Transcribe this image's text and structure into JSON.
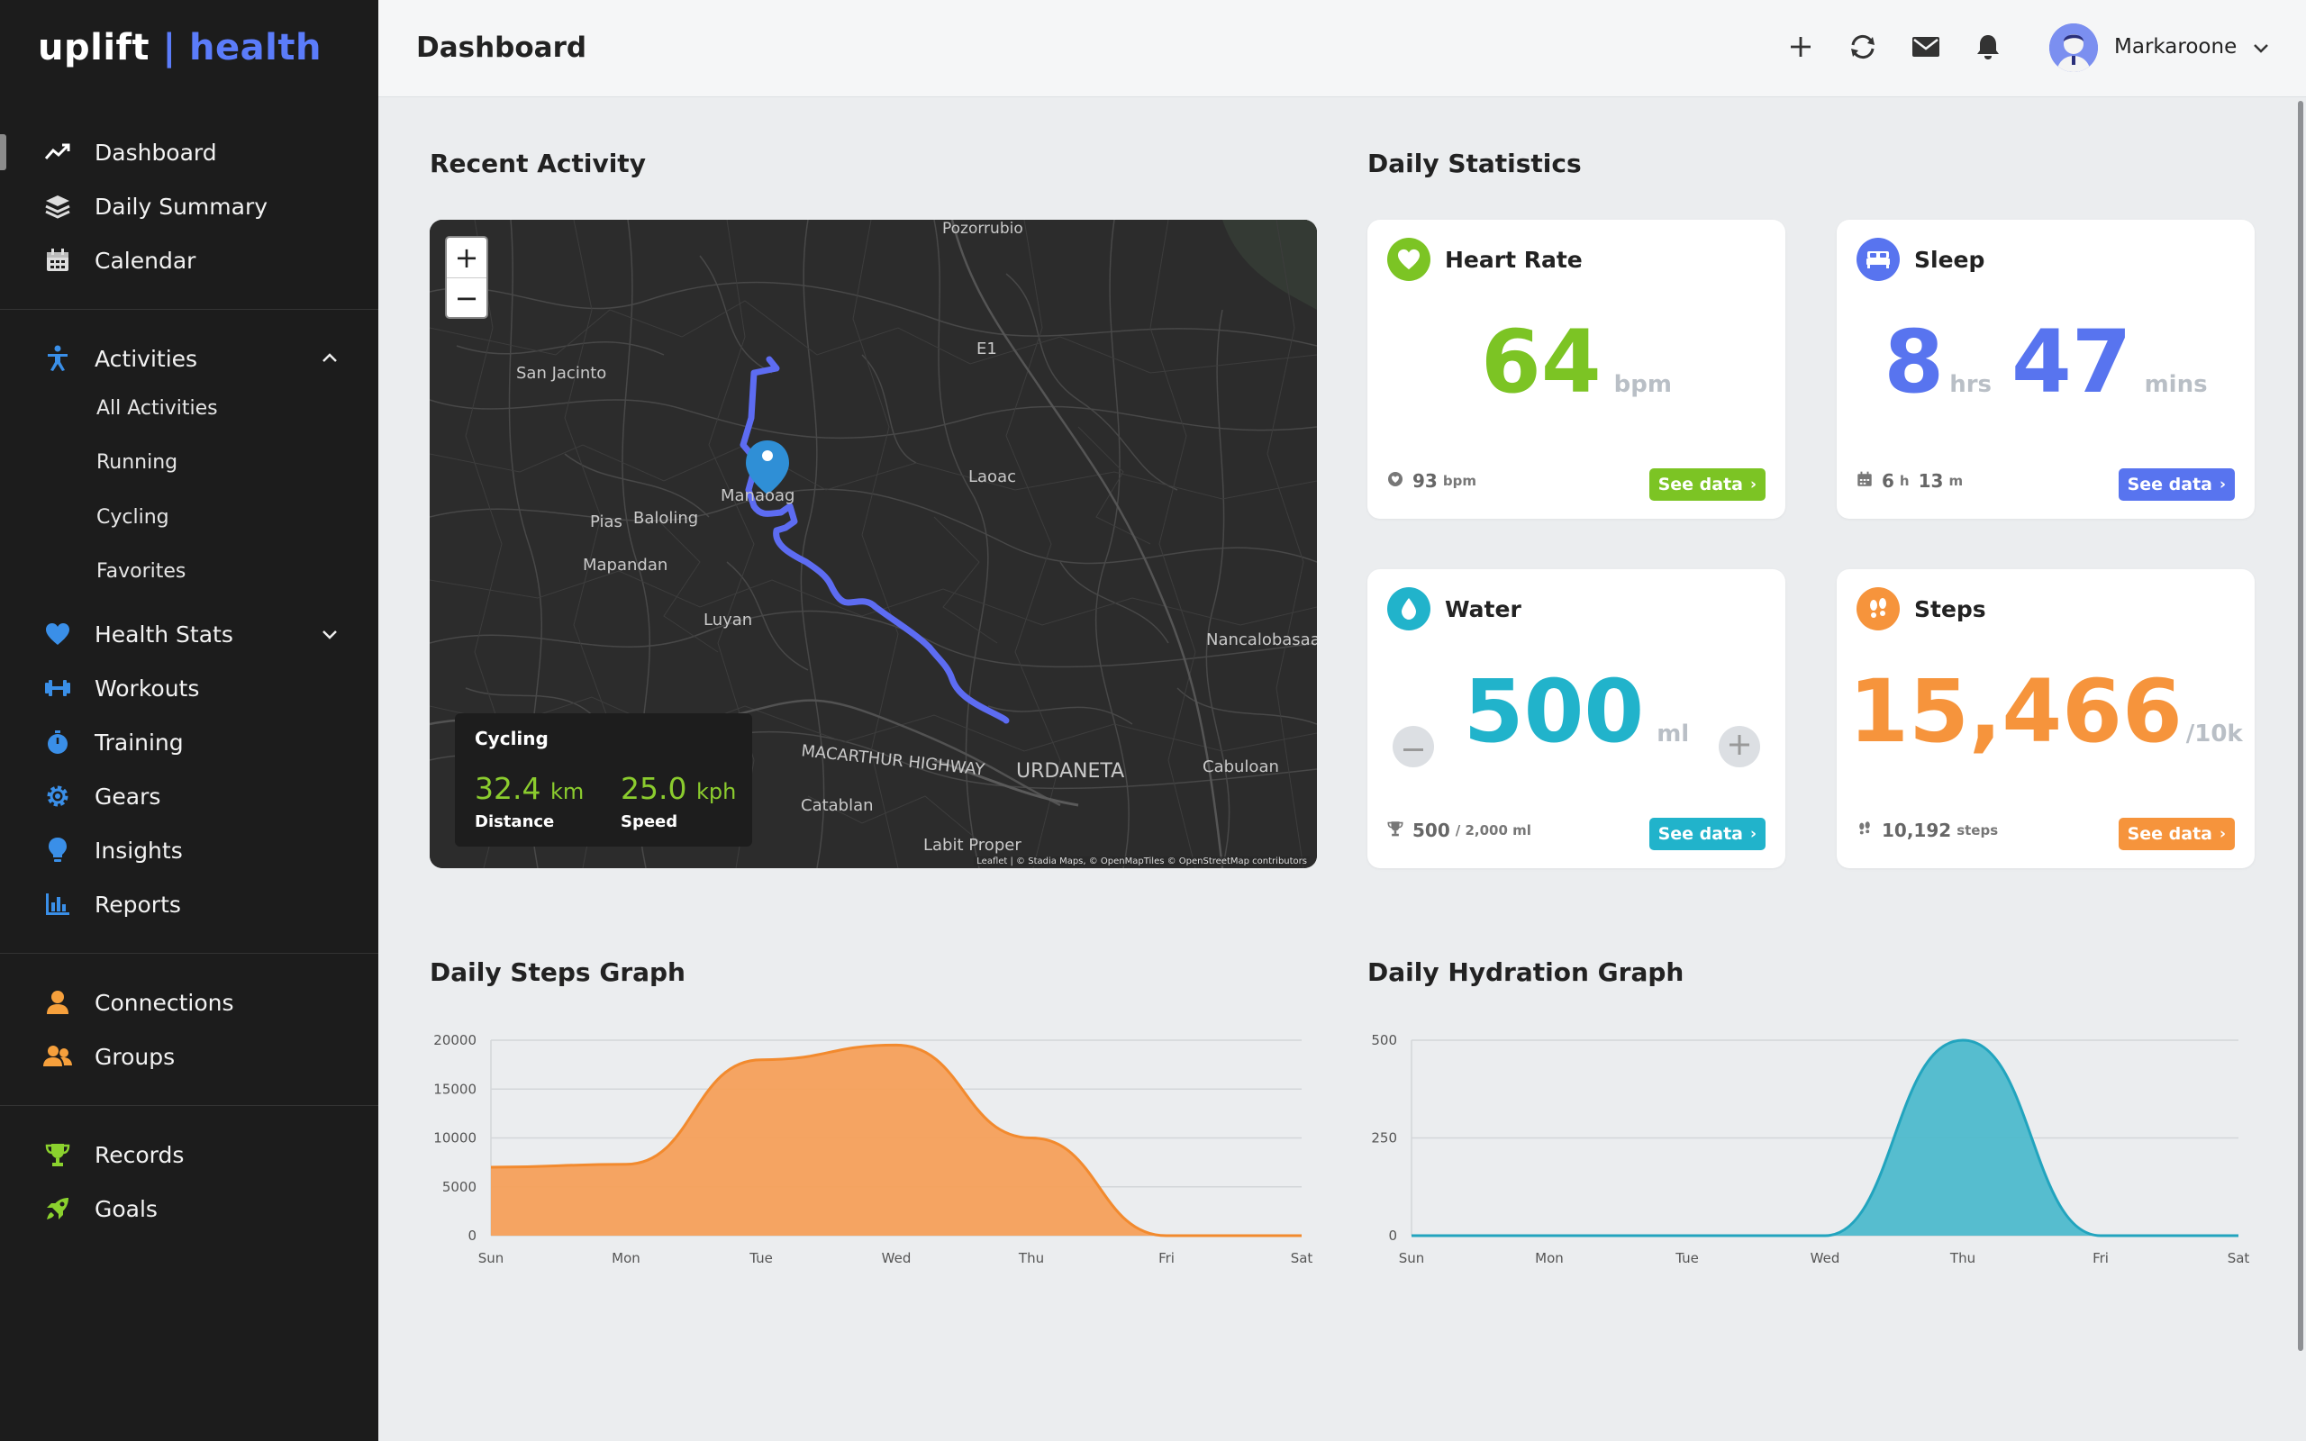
{
  "brand": {
    "part1": "uplift",
    "sep": " | ",
    "part2": "health"
  },
  "sidebar": {
    "items": [
      {
        "label": "Dashboard",
        "icon": "chart-line-icon"
      },
      {
        "label": "Daily Summary",
        "icon": "layers-icon"
      },
      {
        "label": "Calendar",
        "icon": "calendar-icon"
      },
      {
        "label": "Activities",
        "icon": "person-running-icon"
      },
      {
        "label": "Health Stats",
        "icon": "heart-icon"
      },
      {
        "label": "Workouts",
        "icon": "dumbbell-icon"
      },
      {
        "label": "Training",
        "icon": "stopwatch-icon"
      },
      {
        "label": "Gears",
        "icon": "gear-icon"
      },
      {
        "label": "Insights",
        "icon": "lightbulb-icon"
      },
      {
        "label": "Reports",
        "icon": "bar-chart-icon"
      },
      {
        "label": "Connections",
        "icon": "user-icon"
      },
      {
        "label": "Groups",
        "icon": "users-icon"
      },
      {
        "label": "Records",
        "icon": "trophy-icon"
      },
      {
        "label": "Goals",
        "icon": "rocket-icon"
      }
    ],
    "activities_sub": [
      "All Activities",
      "Running",
      "Cycling",
      "Favorites"
    ]
  },
  "header": {
    "title": "Dashboard",
    "user_name": "Markaroone"
  },
  "recent_activity": {
    "title": "Recent Activity",
    "map_labels": [
      "Pozorrubio",
      "E1",
      "San Jacinto",
      "Manaoag",
      "Laoac",
      "Pias",
      "Baloling",
      "Mapandan",
      "Luyan",
      "Nancalobasaan",
      "MACARTHUR HIGHWAY",
      "URDANETA",
      "Cabuloan",
      "Catablan",
      "Labit Proper"
    ],
    "attribution": "Leaflet | © Stadia Maps, © OpenMapTiles © OpenStreetMap contributors",
    "zoom_in": "+",
    "zoom_out": "−",
    "activity_type": "Cycling",
    "distance_value": "32.4",
    "distance_unit": "km",
    "distance_label": "Distance",
    "speed_value": "25.0",
    "speed_unit": "kph",
    "speed_label": "Speed"
  },
  "daily_statistics": {
    "title": "Daily Statistics",
    "heart_rate": {
      "title": "Heart Rate",
      "value": "64",
      "unit": "bpm",
      "foot_value": "93",
      "foot_unit": "bpm",
      "button": "See data",
      "color": "#7cc424"
    },
    "sleep": {
      "title": "Sleep",
      "hours": "8",
      "hours_unit": "hrs",
      "mins": "47",
      "mins_unit": "mins",
      "foot_h": "6",
      "foot_h_unit": "h",
      "foot_m": "13",
      "foot_m_unit": "m",
      "button": "See data",
      "color": "#5874ef"
    },
    "water": {
      "title": "Water",
      "value": "500",
      "unit": "ml",
      "foot_value": "500",
      "foot_unit": "/ 2,000 ml",
      "button": "See data",
      "color": "#21b3cb"
    },
    "steps": {
      "title": "Steps",
      "value": "15,466",
      "unit": "/10k",
      "foot_value": "10,192",
      "foot_unit": "steps",
      "button": "See data",
      "color": "#f6943c"
    }
  },
  "steps_graph_title": "Daily Steps Graph",
  "hydration_graph_title": "Daily Hydration Graph",
  "chart_data": [
    {
      "type": "area",
      "title": "Daily Steps Graph",
      "categories": [
        "Sun",
        "Mon",
        "Tue",
        "Wed",
        "Thu",
        "Fri",
        "Sat"
      ],
      "series": [
        {
          "values": [
            7000,
            7300,
            18000,
            19500,
            10000,
            0,
            0
          ]
        }
      ],
      "ylim": [
        0,
        20000
      ],
      "yticks": [
        0,
        5000,
        10000,
        15000,
        20000
      ],
      "color": "#f6a05a",
      "stroke": "#f28a2e",
      "grid": true
    },
    {
      "type": "area",
      "title": "Daily Hydration Graph",
      "categories": [
        "Sun",
        "Mon",
        "Tue",
        "Wed",
        "Thu",
        "Fri",
        "Sat"
      ],
      "series": [
        {
          "values": [
            0,
            0,
            0,
            0,
            500,
            0,
            0
          ]
        }
      ],
      "ylim": [
        0,
        500
      ],
      "yticks": [
        0,
        250,
        500
      ],
      "color": "#4ebacc",
      "stroke": "#22a4be",
      "grid": true
    }
  ]
}
